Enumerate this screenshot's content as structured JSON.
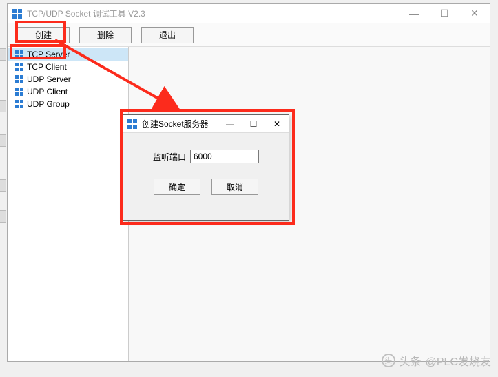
{
  "titlebar": {
    "title": "TCP/UDP Socket 调试工具 V2.3"
  },
  "toolbar": {
    "create": "创建",
    "delete": "删除",
    "exit": "退出"
  },
  "sidebar": {
    "items": [
      {
        "label": "TCP Server"
      },
      {
        "label": "TCP Client"
      },
      {
        "label": "UDP Server"
      },
      {
        "label": "UDP Client"
      },
      {
        "label": "UDP Group"
      }
    ]
  },
  "dialog": {
    "title": "创建Socket服务器",
    "port_label": "监听端口",
    "port_value": "6000",
    "ok": "确定",
    "cancel": "取消"
  },
  "watermark": {
    "prefix": "头条",
    "handle": "@PLC发烧友"
  },
  "winbtn": {
    "min": "—",
    "max": "☐",
    "close": "✕"
  }
}
